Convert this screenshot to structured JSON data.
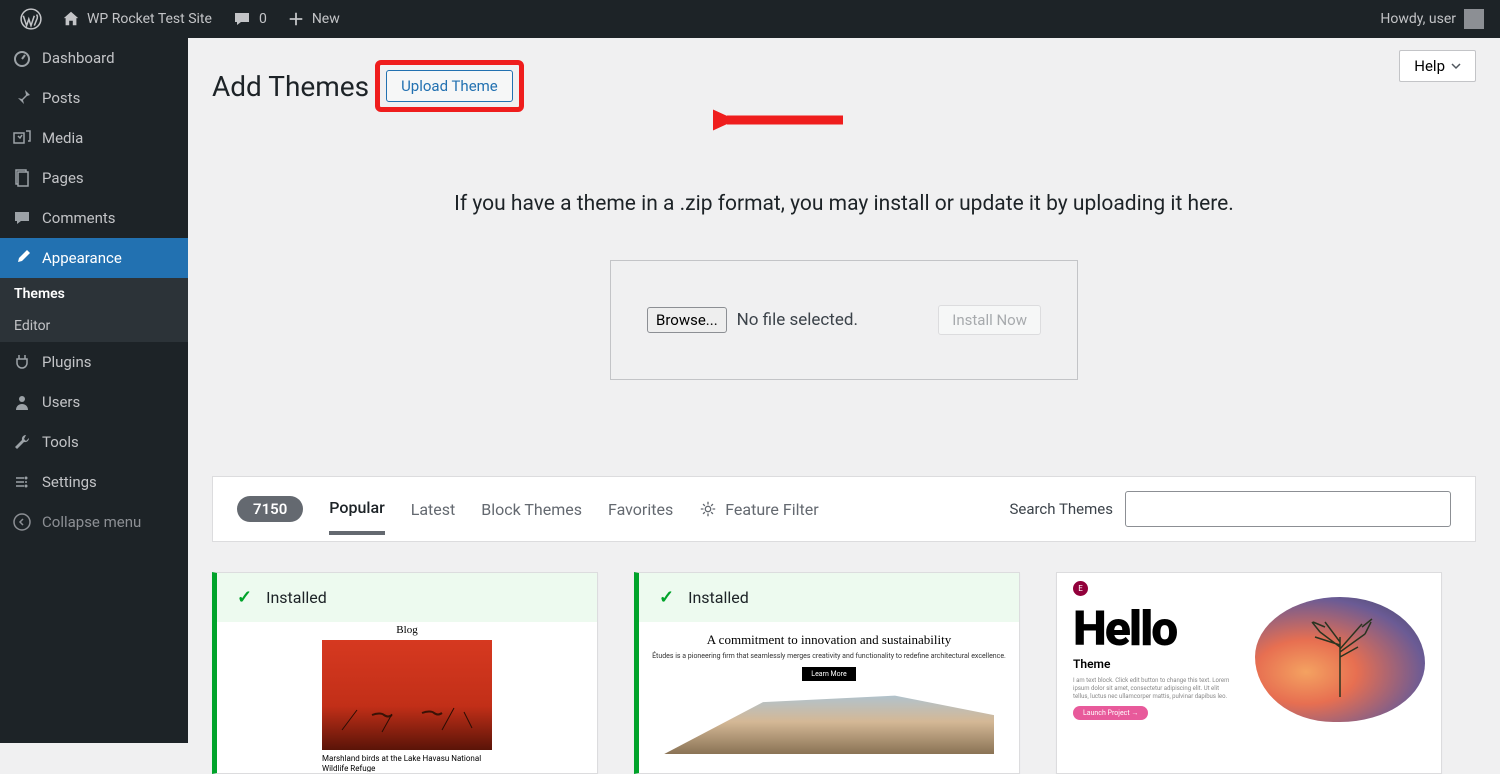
{
  "adminbar": {
    "site_title": "WP Rocket Test Site",
    "comments_count": "0",
    "new_label": "New",
    "howdy": "Howdy, user"
  },
  "sidebar": {
    "items": [
      {
        "label": "Dashboard",
        "icon": "gauge"
      },
      {
        "label": "Posts",
        "icon": "pin"
      },
      {
        "label": "Media",
        "icon": "media"
      },
      {
        "label": "Pages",
        "icon": "pages"
      },
      {
        "label": "Comments",
        "icon": "comment"
      },
      {
        "label": "Appearance",
        "icon": "brush",
        "active": true
      },
      {
        "label": "Plugins",
        "icon": "plug"
      },
      {
        "label": "Users",
        "icon": "user"
      },
      {
        "label": "Tools",
        "icon": "wrench"
      },
      {
        "label": "Settings",
        "icon": "settings"
      }
    ],
    "submenu": [
      {
        "label": "Themes",
        "current": true
      },
      {
        "label": "Editor"
      }
    ],
    "collapse": "Collapse menu"
  },
  "page": {
    "title": "Add Themes",
    "upload_button": "Upload Theme",
    "help": "Help",
    "upload_instruction": "If you have a theme in a .zip format, you may install or update it by uploading it here.",
    "browse": "Browse...",
    "no_file": "No file selected.",
    "install_now": "Install Now"
  },
  "filter": {
    "count": "7150",
    "tabs": [
      "Popular",
      "Latest",
      "Block Themes",
      "Favorites"
    ],
    "feature_filter": "Feature Filter",
    "search_label": "Search Themes"
  },
  "themes": [
    {
      "installed": true,
      "installed_label": "Installed",
      "preview": {
        "title": "Blog",
        "caption": "Marshland birds at the Lake Havasu National Wildlife Refuge"
      }
    },
    {
      "installed": true,
      "installed_label": "Installed",
      "preview": {
        "title": "A commitment to innovation and sustainability",
        "sub": "Études is a pioneering firm that seamlessly merges creativity and functionality to redefine architectural excellence.",
        "btn": "Learn More"
      }
    },
    {
      "installed": false,
      "preview": {
        "hello": "Hello",
        "theme_label": "Theme",
        "text": "I am text block. Click edit button to change this text. Lorem ipsum dolor sit amet, consectetur adipiscing elit. Ut elit tellus, luctus nec ullamcorper mattis, pulvinar dapibus leo.",
        "btn": "Launch Project"
      }
    }
  ]
}
